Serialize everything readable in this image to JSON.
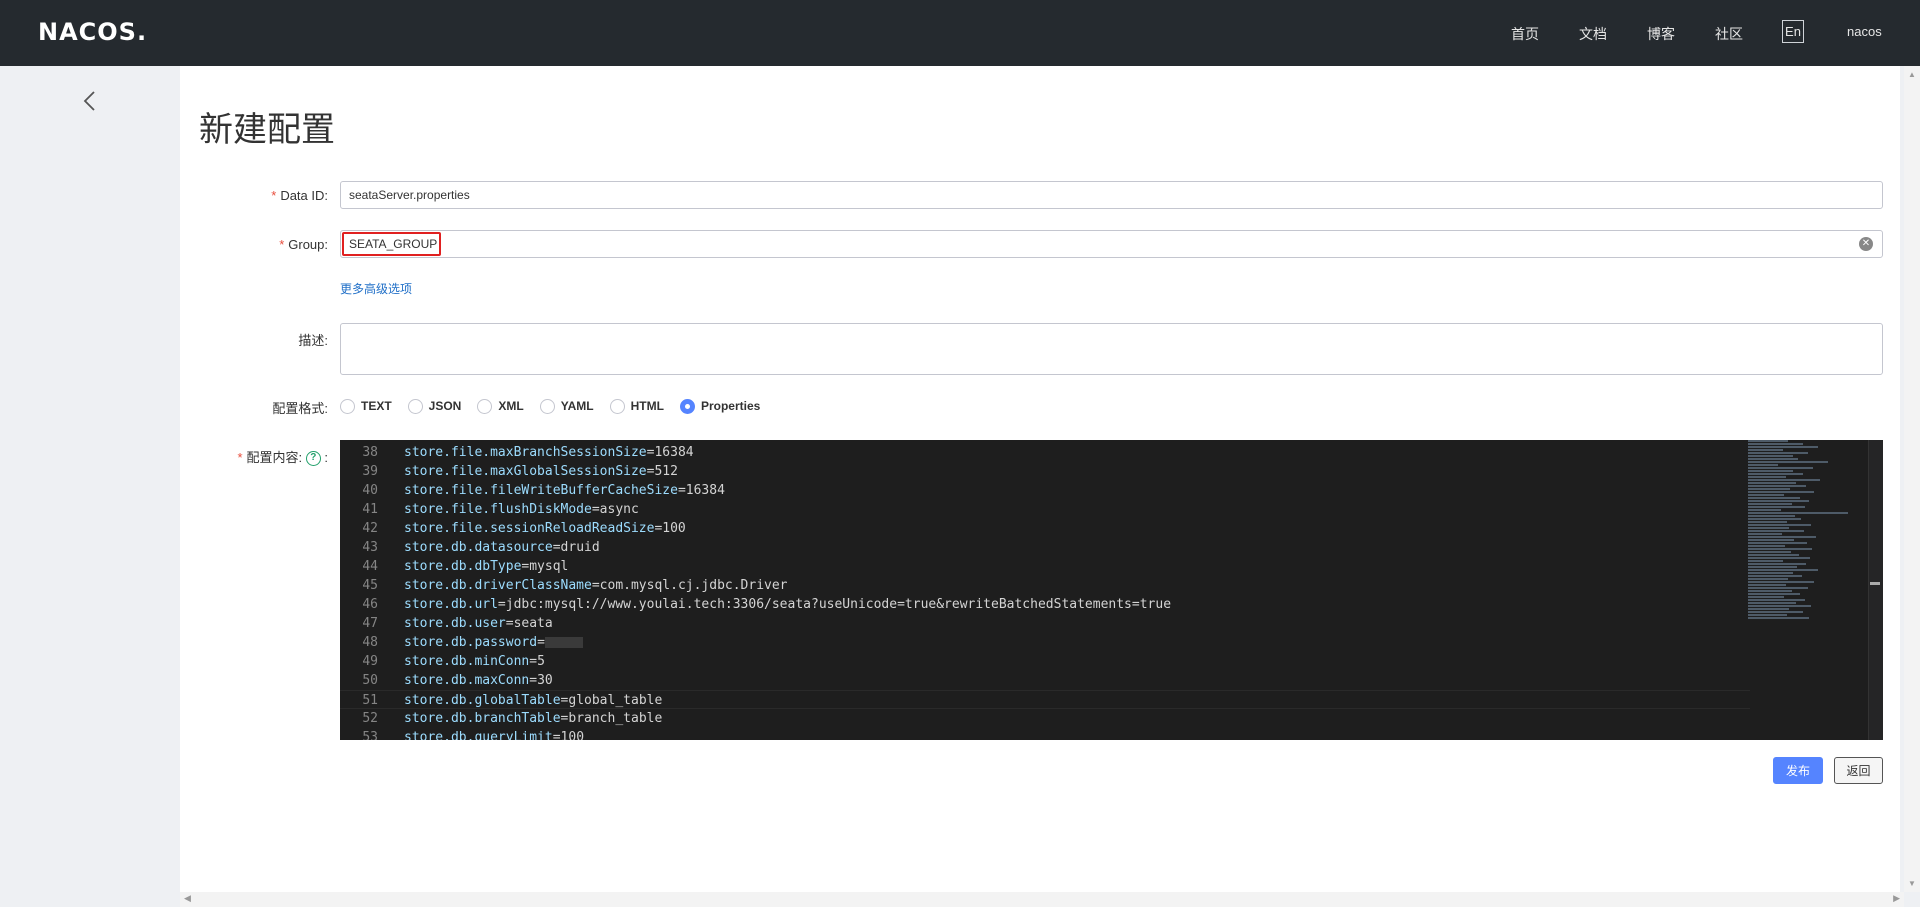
{
  "header": {
    "logo": "NACOS.",
    "nav": [
      "首页",
      "文档",
      "博客",
      "社区"
    ],
    "lang_button": "En",
    "user": "nacos"
  },
  "page": {
    "title": "新建配置"
  },
  "form": {
    "data_id_label": "Data ID:",
    "data_id_value": "seataServer.properties",
    "group_label": "Group:",
    "group_value": "SEATA_GROUP",
    "advanced_link": "更多高级选项",
    "desc_label": "描述:",
    "format_label": "配置格式:",
    "formats": [
      "TEXT",
      "JSON",
      "XML",
      "YAML",
      "HTML",
      "Properties"
    ],
    "selected_format": "Properties",
    "content_label": "配置内容:",
    "required_mark": "*"
  },
  "editor": {
    "lines": [
      {
        "n": "38",
        "key": "store.file.maxBranchSessionSize",
        "val": "16384"
      },
      {
        "n": "39",
        "key": "store.file.maxGlobalSessionSize",
        "val": "512"
      },
      {
        "n": "40",
        "key": "store.file.fileWriteBufferCacheSize",
        "val": "16384"
      },
      {
        "n": "41",
        "key": "store.file.flushDiskMode",
        "val": "async"
      },
      {
        "n": "42",
        "key": "store.file.sessionReloadReadSize",
        "val": "100"
      },
      {
        "n": "43",
        "key": "store.db.datasource",
        "val": "druid"
      },
      {
        "n": "44",
        "key": "store.db.dbType",
        "val": "mysql"
      },
      {
        "n": "45",
        "key": "store.db.driverClassName",
        "val": "com.mysql.cj.jdbc.Driver"
      },
      {
        "n": "46",
        "key": "store.db.url",
        "val": "jdbc:mysql://www.youlai.tech:3306/seata?useUnicode=true&rewriteBatchedStatements=true"
      },
      {
        "n": "47",
        "key": "store.db.user",
        "val": "seata"
      },
      {
        "n": "48",
        "key": "store.db.password",
        "val": "",
        "masked": true
      },
      {
        "n": "49",
        "key": "store.db.minConn",
        "val": "5"
      },
      {
        "n": "50",
        "key": "store.db.maxConn",
        "val": "30"
      },
      {
        "n": "51",
        "key": "store.db.globalTable",
        "val": "global_table",
        "active": true
      },
      {
        "n": "52",
        "key": "store.db.branchTable",
        "val": "branch_table"
      },
      {
        "n": "53",
        "key": "store.db.queryLimit",
        "val": "100"
      }
    ]
  },
  "actions": {
    "publish": "发布",
    "back": "返回"
  }
}
